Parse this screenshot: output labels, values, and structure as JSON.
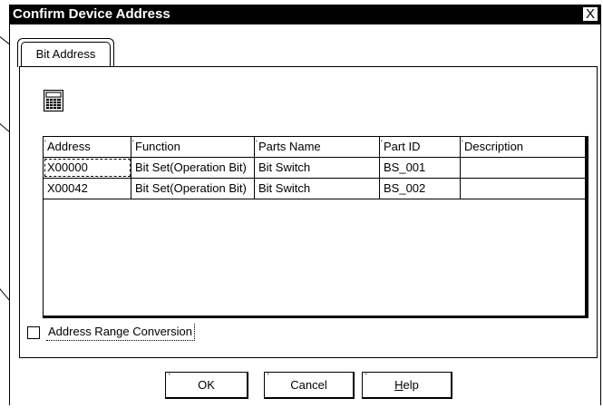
{
  "dialog": {
    "title": "Confirm Device Address",
    "close_glyph": "X"
  },
  "tab": {
    "label": "Bit Address"
  },
  "toolbar": {
    "icon": "calculator-icon"
  },
  "table": {
    "headers": [
      "Address",
      "Function",
      "Parts Name",
      "Part ID",
      "Description"
    ],
    "rows": [
      [
        "X00000",
        "Bit Set(Operation Bit)",
        "Bit Switch",
        "BS_001",
        ""
      ],
      [
        "X00042",
        "Bit Set(Operation Bit)",
        "Bit Switch",
        "BS_002",
        ""
      ]
    ]
  },
  "option": {
    "label": "Address Range Conversion",
    "checked": false
  },
  "buttons": {
    "ok": "OK",
    "cancel": "Cancel",
    "help": "Help"
  }
}
